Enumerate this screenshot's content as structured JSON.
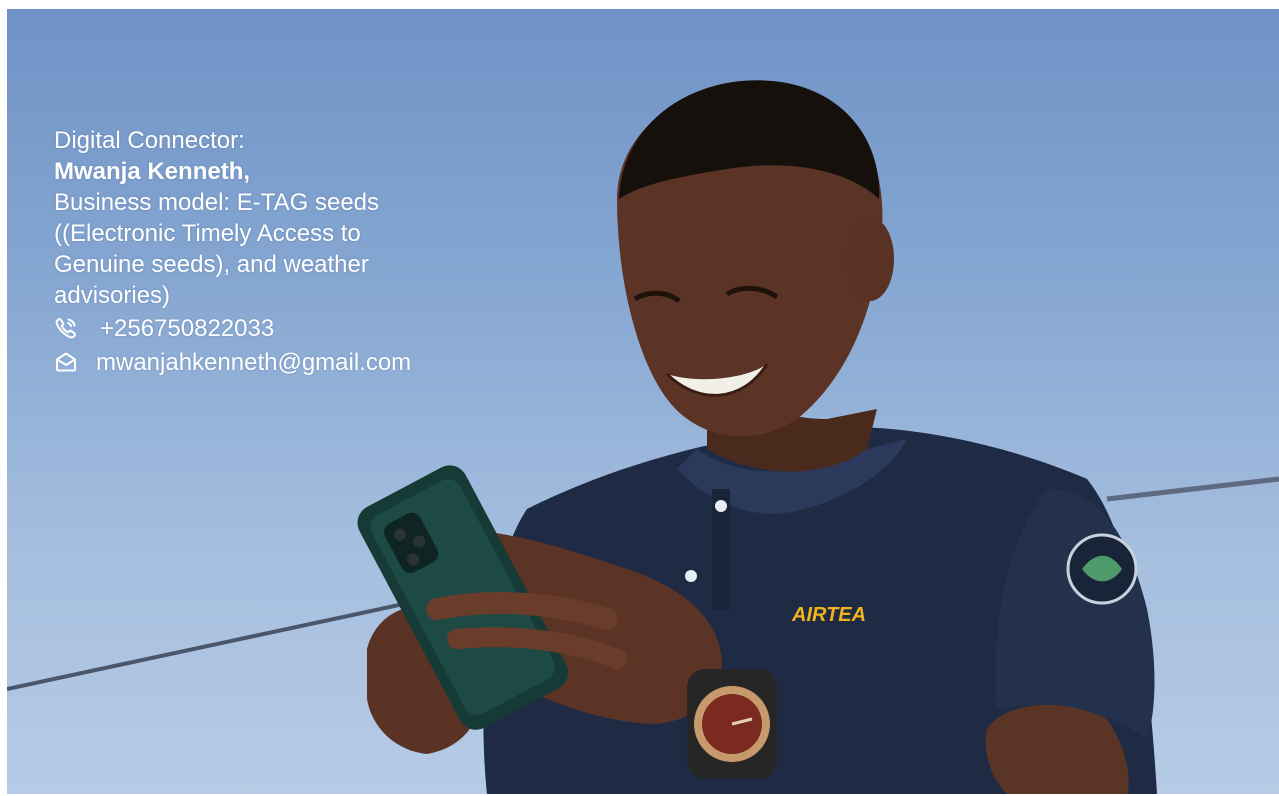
{
  "caption": {
    "role_label": "Digital Connector:",
    "name": "Mwanja Kenneth,",
    "business_lines": [
      "Business model: E-TAG seeds",
      "((Electronic Timely Access to",
      "Genuine seeds), and weather",
      "advisories)"
    ],
    "phone": "+256750822033",
    "email": "mwanjahkenneth@gmail.com"
  },
  "photo": {
    "shirt_logo_text": "AIRTEA",
    "sky_color": "#7f9fcd",
    "shirt_color": "#1f2b44"
  },
  "icons": {
    "phone": "phone-icon",
    "email": "envelope-icon"
  }
}
